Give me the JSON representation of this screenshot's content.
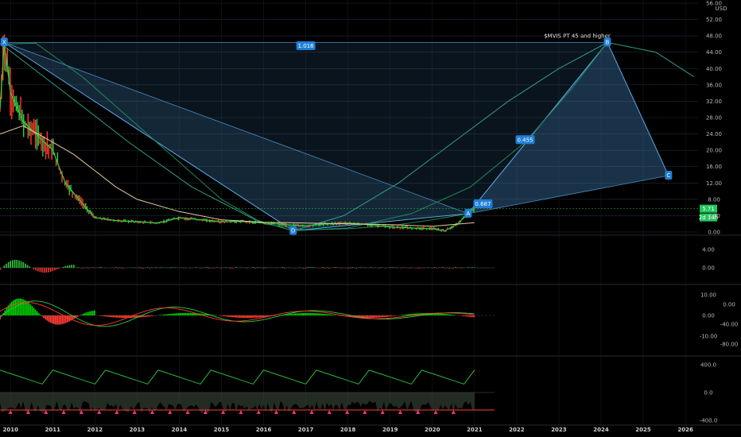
{
  "chart_data": {
    "type": "line",
    "currency": "USD",
    "annotation": "$MVIS PT 45 and higher",
    "price_axis": {
      "min": 0,
      "max": 56,
      "ticks": [
        "56.00",
        "52.00",
        "48.00",
        "44.00",
        "40.00",
        "36.00",
        "32.00",
        "28.00",
        "24.00",
        "20.00",
        "16.00",
        "12.00",
        "8.00",
        "4.00",
        "0.00"
      ]
    },
    "time_axis": {
      "start": 2009.75,
      "end": 2026.3,
      "ticks": [
        "2010",
        "2011",
        "2012",
        "2013",
        "2014",
        "2015",
        "2016",
        "2017",
        "2018",
        "2019",
        "2020",
        "2021",
        "2022",
        "2023",
        "2024",
        "2025",
        "2026"
      ]
    },
    "last_price": {
      "value": 5.71,
      "label": "5.71",
      "countdown": "2d 14h",
      "color": "#22c55e"
    },
    "pattern": {
      "name": "XABCD",
      "points": [
        {
          "label": "X",
          "x": 2009.85,
          "y": 46.4
        },
        {
          "label": "D",
          "x": 2016.7,
          "y": 0.3
        },
        {
          "label": "A",
          "x": 2020.85,
          "y": 4.5
        },
        {
          "label": "B",
          "x": 2024.15,
          "y": 46.4
        },
        {
          "label": "C",
          "x": 2025.6,
          "y": 13.8
        }
      ],
      "ratios": [
        {
          "label": "1.016",
          "x": 2017.0,
          "y": 45.5
        },
        {
          "label": "0.455",
          "x": 2022.2,
          "y": 22.5
        },
        {
          "label": "0.687",
          "x": 2021.2,
          "y": 6.8
        }
      ],
      "fill_color": "#3a6f9f",
      "line_color": "#5aa8e6"
    },
    "price_series": [
      {
        "name": "price",
        "color": "#2ecc40",
        "x": [
          2009.75,
          2009.85,
          2010.0,
          2010.3,
          2010.6,
          2011.0,
          2011.3,
          2011.7,
          2012.0,
          2012.5,
          2013.0,
          2013.5,
          2014.0,
          2014.5,
          2015.0,
          2015.5,
          2016.0,
          2016.5,
          2017.0,
          2017.5,
          2018.0,
          2018.5,
          2019.0,
          2019.5,
          2020.0,
          2020.3,
          2020.6,
          2020.85,
          2021.0
        ],
        "y": [
          30.0,
          46.4,
          34.0,
          27.0,
          24.0,
          20.0,
          12.0,
          7.0,
          3.5,
          2.8,
          2.5,
          2.2,
          3.5,
          3.0,
          2.5,
          2.6,
          2.2,
          1.8,
          1.5,
          2.0,
          2.2,
          1.8,
          1.2,
          1.0,
          0.8,
          0.3,
          2.0,
          4.5,
          5.71
        ]
      },
      {
        "name": "ma-slow",
        "color": "#e8c9a0",
        "x": [
          2009.75,
          2010.3,
          2011.0,
          2011.5,
          2012.0,
          2012.5,
          2013.0,
          2014.0,
          2015.0,
          2016.0,
          2017.0,
          2018.0,
          2019.0,
          2020.0,
          2021.0
        ],
        "y": [
          24.0,
          26.0,
          22.0,
          19.0,
          15.0,
          11.0,
          8.0,
          5.0,
          3.0,
          2.4,
          2.2,
          2.0,
          1.8,
          1.4,
          2.3
        ]
      }
    ],
    "arcs": [
      {
        "color": "#2e9e86",
        "x": [
          2009.75,
          2011.3,
          2012.8,
          2014.3,
          2015.8,
          2016.7,
          2017.9,
          2019.2,
          2020.5,
          2021.8,
          2023.0,
          2024.15,
          2025.3,
          2026.2
        ],
        "y": [
          46.2,
          34.0,
          22.0,
          11.0,
          3.0,
          0.3,
          4.0,
          12.0,
          22.0,
          32.0,
          40.0,
          46.4,
          44.0,
          38.0
        ]
      },
      {
        "color": "#1f8a5e",
        "x": [
          2009.75,
          2010.6,
          2011.7,
          2012.8,
          2013.9,
          2015.0,
          2016.0,
          2017.0,
          2018.0,
          2019.0,
          2020.0,
          2020.85
        ],
        "y": [
          46.0,
          46.2,
          38.0,
          28.0,
          18.0,
          8.0,
          2.0,
          0.5,
          0.8,
          1.5,
          3.0,
          4.5
        ]
      },
      {
        "color": "#1f8a5e",
        "x": [
          2016.7,
          2018.0,
          2019.5,
          2020.9,
          2022.2,
          2023.3,
          2024.15
        ],
        "y": [
          0.3,
          1.0,
          4.5,
          11.0,
          22.0,
          35.0,
          46.4
        ]
      }
    ],
    "panes": [
      {
        "name": "oscillator-1",
        "ticks": [
          "4.00",
          "0.00"
        ]
      },
      {
        "name": "oscillator-2",
        "ticks": [
          "10.00",
          "0.00",
          "-10.00"
        ],
        "right_ticks": [
          "0.00",
          "-40.00",
          "-80.00"
        ]
      },
      {
        "name": "oscillator-3",
        "ticks": [
          "400.0",
          "0.0",
          "-400.0"
        ]
      }
    ],
    "colors": {
      "up": "#2ecc40",
      "down": "#ff3b30",
      "macd": "#00c800",
      "signal": "#ff3b30",
      "grid": "#1f2a3a"
    }
  }
}
